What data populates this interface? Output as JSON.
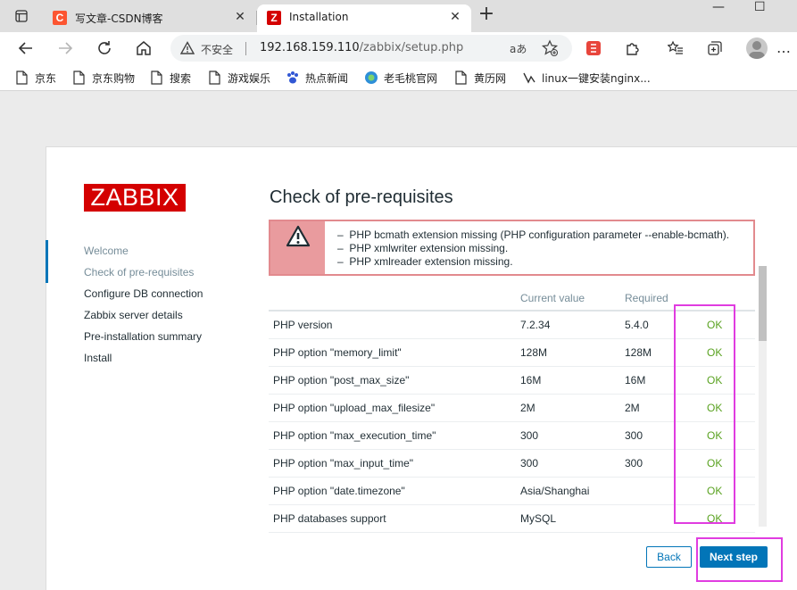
{
  "browser": {
    "tabs": [
      {
        "title": "写文章-CSDN博客",
        "favicon": "C",
        "favicon_color": "#fc5531",
        "active": false
      },
      {
        "title": "Installation",
        "favicon": "Z",
        "favicon_color": "#d40000",
        "active": true
      }
    ],
    "close_glyph": "✕",
    "new_tab_glyph": "+",
    "window_controls": {
      "minimize": "—",
      "maximize": "☐"
    },
    "address": {
      "security_label": "不安全",
      "url_host": "192.168.159.110",
      "url_path": "/zabbix/setup.php",
      "read_aloud": "aあ"
    },
    "bookmarks": [
      {
        "label": "京东",
        "icon": "page-icon"
      },
      {
        "label": "京东购物",
        "icon": "page-icon"
      },
      {
        "label": "搜索",
        "icon": "page-icon"
      },
      {
        "label": "游戏娱乐",
        "icon": "page-icon"
      },
      {
        "label": "热点新闻",
        "icon": "paw-icon"
      },
      {
        "label": "老毛桃官网",
        "icon": "globe-icon"
      },
      {
        "label": "黄历网",
        "icon": "page-icon"
      },
      {
        "label": "linux一键安装nginx...",
        "icon": "wave-icon"
      }
    ],
    "menu_glyph": "…"
  },
  "setup": {
    "logo": "ZABBIX",
    "steps": [
      {
        "label": "Welcome",
        "state": "done"
      },
      {
        "label": "Check of pre-requisites",
        "state": "current"
      },
      {
        "label": "Configure DB connection",
        "state": "pending"
      },
      {
        "label": "Zabbix server details",
        "state": "pending"
      },
      {
        "label": "Pre-installation summary",
        "state": "pending"
      },
      {
        "label": "Install",
        "state": "pending"
      }
    ],
    "title": "Check of pre-requisites",
    "errors": [
      "PHP bcmath extension missing (PHP configuration parameter --enable-bcmath).",
      "PHP xmlwriter extension missing.",
      "PHP xmlreader extension missing."
    ],
    "table": {
      "headers": [
        "",
        "Current value",
        "Required",
        ""
      ],
      "rows": [
        {
          "name": "PHP version",
          "current": "7.2.34",
          "required": "5.4.0",
          "status": "OK"
        },
        {
          "name": "PHP option \"memory_limit\"",
          "current": "128M",
          "required": "128M",
          "status": "OK"
        },
        {
          "name": "PHP option \"post_max_size\"",
          "current": "16M",
          "required": "16M",
          "status": "OK"
        },
        {
          "name": "PHP option \"upload_max_filesize\"",
          "current": "2M",
          "required": "2M",
          "status": "OK"
        },
        {
          "name": "PHP option \"max_execution_time\"",
          "current": "300",
          "required": "300",
          "status": "OK"
        },
        {
          "name": "PHP option \"max_input_time\"",
          "current": "300",
          "required": "300",
          "status": "OK"
        },
        {
          "name": "PHP option \"date.timezone\"",
          "current": "Asia/Shanghai",
          "required": "",
          "status": "OK"
        },
        {
          "name": "PHP databases support",
          "current": "MySQL",
          "required": "",
          "status": "OK"
        }
      ]
    },
    "buttons": {
      "back": "Back",
      "next": "Next step"
    },
    "colors": {
      "brand": "#d40000",
      "accent": "#0275b8",
      "ok": "#59a220",
      "error_bg": "#e99b9e",
      "highlight": "#e03ce0"
    }
  }
}
